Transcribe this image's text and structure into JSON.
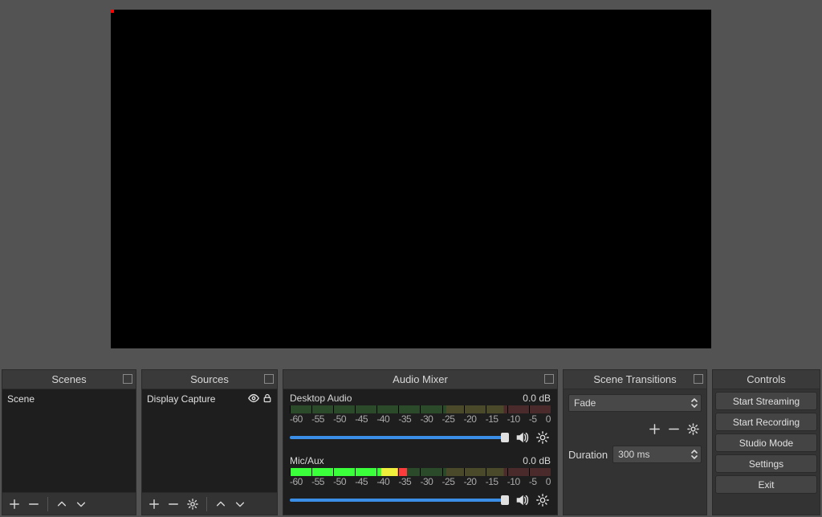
{
  "panels": {
    "scenes": "Scenes",
    "sources": "Sources",
    "mixer": "Audio Mixer",
    "transitions": "Scene Transitions",
    "controls": "Controls"
  },
  "scenes": {
    "items": [
      "Scene"
    ]
  },
  "sources": {
    "items": [
      "Display Capture"
    ]
  },
  "mixer": {
    "channels": [
      {
        "name": "Desktop Audio",
        "level": "0.0 dB",
        "fill_pct": 0
      },
      {
        "name": "Mic/Aux",
        "level": "0.0 dB",
        "fill_pct": 45
      }
    ],
    "scale": [
      "-60",
      "-55",
      "-50",
      "-45",
      "-40",
      "-35",
      "-30",
      "-25",
      "-20",
      "-15",
      "-10",
      "-5",
      "0"
    ]
  },
  "transitions": {
    "selected": "Fade",
    "duration_label": "Duration",
    "duration_value": "300 ms"
  },
  "controls": {
    "buttons": [
      "Start Streaming",
      "Start Recording",
      "Studio Mode",
      "Settings",
      "Exit"
    ]
  }
}
